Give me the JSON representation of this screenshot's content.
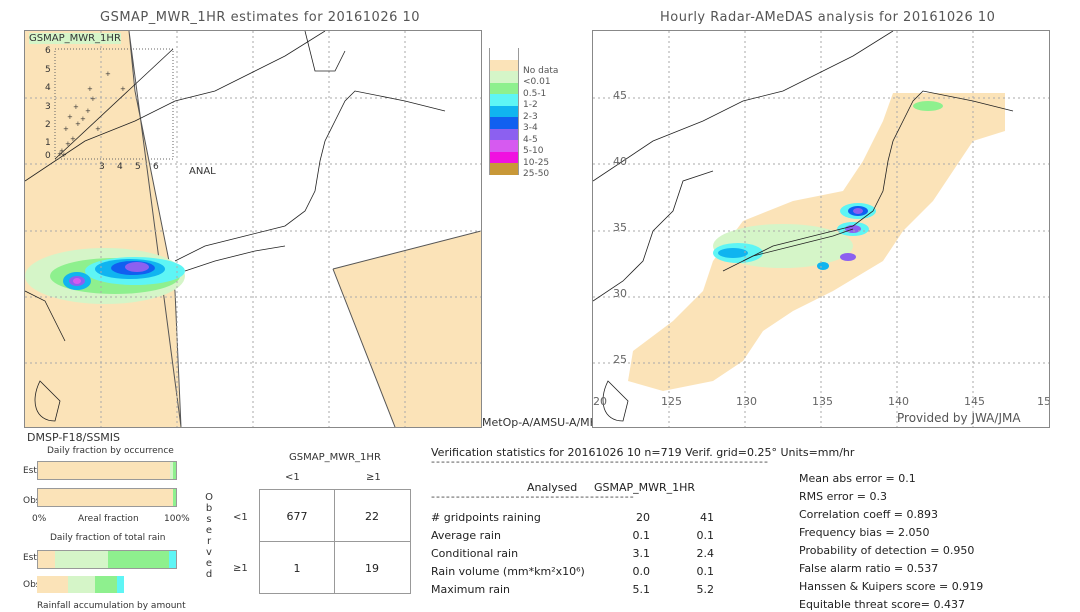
{
  "left_panel": {
    "title": "GSMAP_MWR_1HR estimates for 20161026 10",
    "inset_label": "GSMAP_MWR_1HR",
    "inset_y_ticks": [
      "6",
      "5",
      "4",
      "3",
      "2",
      "1",
      "0"
    ],
    "inset_x_ticks": [
      "3",
      "4",
      "5",
      "6"
    ],
    "inset_x_label": "ANAL",
    "sensor_label_bottom": "DMSP-F18/SSMIS",
    "sensor_label_right": "MetOp-A/AMSU-A/MHS"
  },
  "legend": {
    "items": [
      {
        "label": "",
        "color": "#ffffff"
      },
      {
        "label": "No data",
        "color": "#fbe3b8"
      },
      {
        "label": "<0.01",
        "color": "#d5f5c8"
      },
      {
        "label": "0.5-1",
        "color": "#8ef08e"
      },
      {
        "label": "1-2",
        "color": "#5ef5f5"
      },
      {
        "label": "2-3",
        "color": "#10b4f0"
      },
      {
        "label": "3-4",
        "color": "#1060f0"
      },
      {
        "label": "4-5",
        "color": "#8c60f0"
      },
      {
        "label": "5-10",
        "color": "#d65af0"
      },
      {
        "label": "10-25",
        "color": "#f010e0"
      },
      {
        "label": "25-50",
        "color": "#c89838"
      }
    ]
  },
  "right_panel": {
    "title": "Hourly Radar-AMeDAS analysis for 20161026 10",
    "lat_labels": [
      "45",
      "40",
      "35",
      "30",
      "25",
      "20"
    ],
    "lon_labels": [
      "125",
      "130",
      "135",
      "140",
      "145",
      "15"
    ],
    "credit": "Provided by JWA/JMA"
  },
  "fraction_charts": {
    "occurrence_title": "Daily fraction by occurrence",
    "total_rain_title": "Daily fraction of total rain",
    "accumulation_title": "Rainfall accumulation by amount",
    "est_label": "Est",
    "obs_label": "Obs",
    "axis_left": "0%",
    "axis_mid": "Areal fraction",
    "axis_right": "100%",
    "occurrence_est": [
      0.955,
      0.025,
      0.02
    ],
    "occurrence_obs": [
      0.975,
      0.025
    ],
    "total_est": [
      0.12,
      0.39,
      0.44,
      0.05
    ],
    "total_obs_scale": 0.63,
    "total_obs": [
      0.36,
      0.31,
      0.25,
      0.08
    ]
  },
  "contingency": {
    "model_label": "GSMAP_MWR_1HR",
    "col_headers": [
      "<1",
      "≥1"
    ],
    "row_headers": [
      "<1",
      "≥1"
    ],
    "observed_label": [
      "O",
      "b",
      "s",
      "e",
      "r",
      "v",
      "e",
      "d"
    ],
    "cells": [
      [
        "677",
        "22"
      ],
      [
        "1",
        "19"
      ]
    ]
  },
  "verification": {
    "header": "Verification statistics for 20161026 10   n=719   Verif. grid=0.25°   Units=mm/hr",
    "col_analysed": "Analysed",
    "col_model": "GSMAP_MWR_1HR",
    "rows": [
      {
        "label": "# gridpoints raining",
        "analysed": "20",
        "model": "41"
      },
      {
        "label": "Average rain",
        "analysed": "0.1",
        "model": "0.1"
      },
      {
        "label": "Conditional rain",
        "analysed": "3.1",
        "model": "2.4"
      },
      {
        "label": "Rain volume (mm*km²x10⁶)",
        "analysed": "0.0",
        "model": "0.1"
      },
      {
        "label": "Maximum rain",
        "analysed": "5.1",
        "model": "5.2"
      }
    ],
    "scores": [
      "Mean abs error = 0.1",
      "RMS error = 0.3",
      "Correlation coeff = 0.893",
      "Frequency bias = 2.050",
      "Probability of detection = 0.950",
      "False alarm ratio = 0.537",
      "Hanssen & Kuipers score = 0.919",
      "Equitable threat score= 0.437"
    ]
  }
}
